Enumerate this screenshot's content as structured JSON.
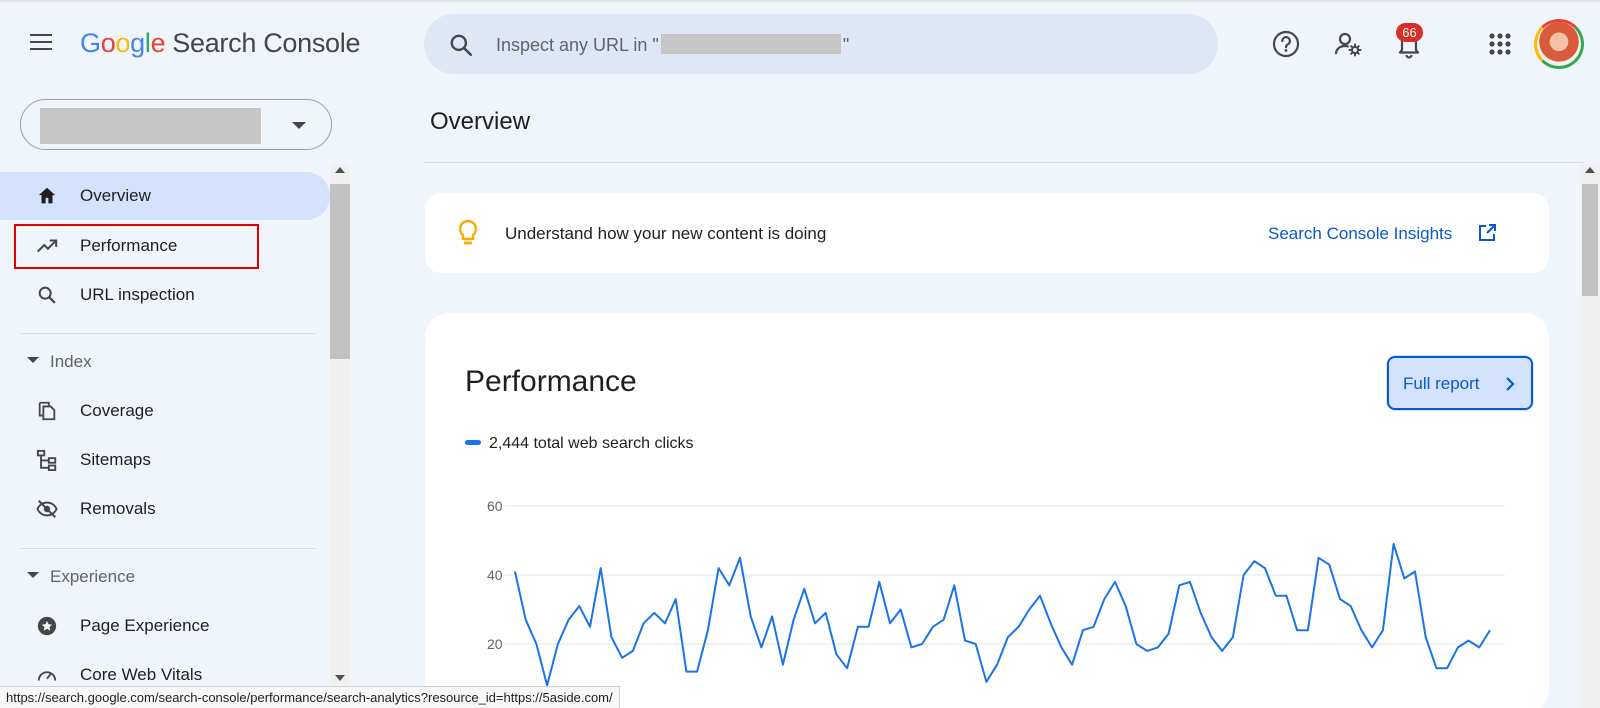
{
  "header": {
    "logo_letters": [
      "G",
      "o",
      "o",
      "g",
      "l",
      "e"
    ],
    "product_name": "Search Console",
    "search_placeholder_prefix": "Inspect any URL in \"",
    "search_placeholder_suffix": "\"",
    "notification_count": "66",
    "icons": [
      "menu-icon",
      "search-icon",
      "help-icon",
      "manage-users-icon",
      "notifications-icon",
      "apps-grid-icon",
      "account-avatar"
    ]
  },
  "sidebar": {
    "items": [
      {
        "label": "Overview",
        "icon": "home-icon",
        "active": true
      },
      {
        "label": "Performance",
        "icon": "trending-up-icon",
        "active": false
      },
      {
        "label": "URL inspection",
        "icon": "search-icon",
        "active": false
      }
    ],
    "sections": [
      {
        "label": "Index",
        "items": [
          {
            "label": "Coverage",
            "icon": "copy-pages-icon"
          },
          {
            "label": "Sitemaps",
            "icon": "sitemap-icon"
          },
          {
            "label": "Removals",
            "icon": "eye-off-icon"
          }
        ]
      },
      {
        "label": "Experience",
        "items": [
          {
            "label": "Page Experience",
            "icon": "star-badge-icon"
          },
          {
            "label": "Core Web Vitals",
            "icon": "speed-gauge-icon"
          }
        ]
      }
    ]
  },
  "main": {
    "title": "Overview",
    "insight_text": "Understand how your new content is doing",
    "insight_link": "Search Console Insights",
    "performance_title": "Performance",
    "full_report_label": "Full report",
    "legend_label": "2,444 total web search clicks"
  },
  "chart_data": {
    "type": "line",
    "ylim": [
      0,
      60
    ],
    "yticks": [
      20,
      40,
      60
    ],
    "grid": true,
    "series": [
      {
        "name": "2,444 total web search clicks",
        "color": "#1a73e8",
        "values": [
          41,
          27,
          20,
          8,
          20,
          27,
          31,
          25,
          42,
          22,
          16,
          18,
          26,
          29,
          26,
          33,
          12,
          12,
          24,
          42,
          37,
          45,
          28,
          19,
          28,
          14,
          27,
          36,
          26,
          29,
          17,
          13,
          25,
          25,
          38,
          26,
          30,
          19,
          20,
          25,
          27,
          37,
          21,
          20,
          9,
          14,
          22,
          25,
          30,
          34,
          26,
          19,
          14,
          24,
          25,
          33,
          38,
          31,
          20,
          18,
          19,
          23,
          37,
          38,
          29,
          22,
          18,
          22,
          40,
          44,
          42,
          34,
          34,
          24,
          24,
          45,
          43,
          33,
          31,
          24,
          19,
          24,
          49,
          39,
          41,
          22,
          13,
          13,
          19,
          21,
          19,
          24
        ]
      }
    ]
  },
  "statusbar": {
    "url": "https://search.google.com/search-console/performance/search-analytics?resource_id=https://5aside.com/"
  },
  "colors": {
    "accent": "#0b57d0",
    "series": "#1a73e8",
    "active_nav": "#d3e3fd",
    "highlight_box": "#e00000",
    "badge": "#d93025"
  }
}
